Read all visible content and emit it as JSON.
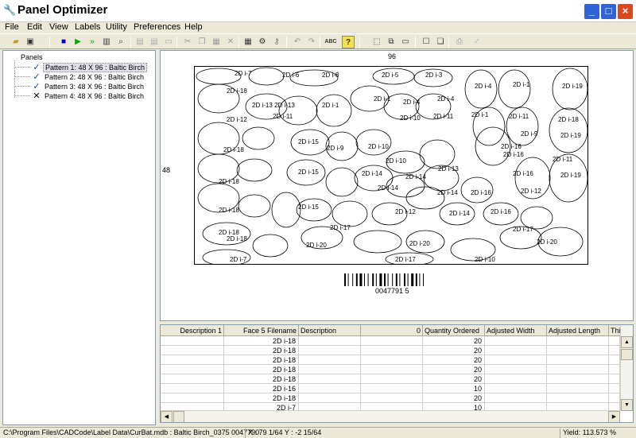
{
  "app": {
    "title": "Panel Optimizer"
  },
  "menu": [
    "File",
    "Edit",
    "View",
    "Labels",
    "Utility",
    "Preferences",
    "Help"
  ],
  "tree": {
    "root": "Panels",
    "items": [
      {
        "label": "Pattern 1:  48 X  96 : Baltic Birch",
        "status": "check",
        "selected": true
      },
      {
        "label": "Pattern 2:  48 X  96 : Baltic Birch",
        "status": "check",
        "selected": false
      },
      {
        "label": "Pattern 3:  48 X  96 : Baltic Birch",
        "status": "check",
        "selected": false
      },
      {
        "label": "Pattern 4:  48 X  96 : Baltic Birch",
        "status": "x",
        "selected": false
      }
    ]
  },
  "canvas": {
    "width_label": "96",
    "height_label": "48",
    "barcode_text": "0047791 5",
    "parts": [
      "2D i-7",
      "2D i-6",
      "2D i-8",
      "2D i-5",
      "2D i-3",
      "2D i-4",
      "2D i-1",
      "2D i-19",
      "2D i-18",
      "2D i-13",
      "2D i-13",
      "2D i-1",
      "2D i-1",
      "2D i-4",
      "2D i-4",
      "2D i-1",
      "2D i-11",
      "2D i-18",
      "2D i-12",
      "2D i-11",
      "2D i-10",
      "2D i-11",
      "2D i-9",
      "2D i-19",
      "2D i-16",
      "2D i-15",
      "2D i-9",
      "2D i-10",
      "2D i-16",
      "2D i-18",
      "2D i-10",
      "2D i-16",
      "2D i-15",
      "2D i-14",
      "2D i-14",
      "2D i-11",
      "2D i-19",
      "2D i-18",
      "2D i-14",
      "2D i-14",
      "2D i-13",
      "2D i-12",
      "2D i-16",
      "2D i-15",
      "2D i-17",
      "2D i-12",
      "2D i-14",
      "2D i-16",
      "2D i-18",
      "2D i-18",
      "2D i-17",
      "2D i-20",
      "2D i-20",
      "2D i-17",
      "2D i-10",
      "2D i-20",
      "2D i-18",
      "2D i-7"
    ]
  },
  "grid": {
    "headers": [
      "Description 1",
      "Face 5 Filename",
      "Description",
      "0",
      "Quantity Ordered",
      "Adjusted Width",
      "Adjusted Length",
      "Thi"
    ],
    "rows": [
      {
        "filename": "2D i-18",
        "qty": "20"
      },
      {
        "filename": "2D i-18",
        "qty": "20"
      },
      {
        "filename": "2D i-18",
        "qty": "20"
      },
      {
        "filename": "2D i-18",
        "qty": "20"
      },
      {
        "filename": "2D i-18",
        "qty": "20"
      },
      {
        "filename": "2D i-16",
        "qty": "10"
      },
      {
        "filename": "2D i-18",
        "qty": "20"
      },
      {
        "filename": "2D i-7",
        "qty": "10"
      }
    ]
  },
  "status": {
    "path": "C:\\Program Files\\CADCode\\Label Data\\CurBat.mdb : Baltic Birch_0375 0047790",
    "coords": "X : 79 1/64 Y : -2 15/64",
    "yield": "Yield: 113.573 %"
  },
  "colors": {
    "accent": "#2f63d6",
    "close": "#d9491f",
    "selection": "#e0e0ea"
  }
}
